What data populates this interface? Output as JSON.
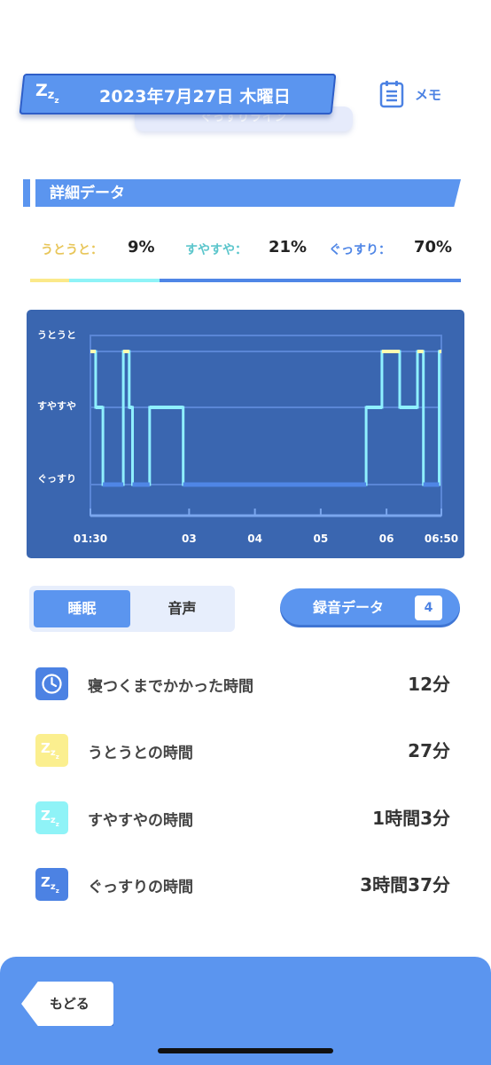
{
  "header": {
    "date": "2023年7月27日 木曜日",
    "memo_label": "メモ",
    "hidden_subtitle": "ぐっすりライン"
  },
  "details": {
    "title": "詳細データ",
    "stats": [
      {
        "label": "うとうと：",
        "value": "9%",
        "color": "#e8c65a"
      },
      {
        "label": "すやすや：",
        "value": "21%",
        "color": "#5cc6cc"
      },
      {
        "label": "ぐっすり：",
        "value": "70%",
        "color": "#4f86e6"
      }
    ]
  },
  "chart_data": {
    "type": "line",
    "step": true,
    "y_levels": [
      "うとうと",
      "すやすや",
      "ぐっすり"
    ],
    "x_ticks": [
      "01:30",
      "03",
      "04",
      "05",
      "06",
      "06:50"
    ],
    "x_range_hours": [
      1.5,
      6.8333
    ],
    "colors": {
      "うとうと": "#fffbb0",
      "すやすや": "#8ff0ff",
      "ぐっすり": "#4f86e6"
    },
    "segments": [
      {
        "start": 1.5,
        "end": 1.58,
        "level": "うとうと"
      },
      {
        "start": 1.58,
        "end": 1.69,
        "level": "すやすや"
      },
      {
        "start": 1.69,
        "end": 2.0,
        "level": "ぐっすり"
      },
      {
        "start": 2.0,
        "end": 2.09,
        "level": "うとうと"
      },
      {
        "start": 2.09,
        "end": 2.14,
        "level": "すやすや"
      },
      {
        "start": 2.14,
        "end": 2.4,
        "level": "ぐっすり"
      },
      {
        "start": 2.4,
        "end": 2.91,
        "level": "すやすや"
      },
      {
        "start": 2.91,
        "end": 5.69,
        "level": "ぐっすり"
      },
      {
        "start": 5.69,
        "end": 5.93,
        "level": "すやすや"
      },
      {
        "start": 5.93,
        "end": 6.2,
        "level": "うとうと"
      },
      {
        "start": 6.2,
        "end": 6.47,
        "level": "すやすや"
      },
      {
        "start": 6.47,
        "end": 6.56,
        "level": "うとうと"
      },
      {
        "start": 6.56,
        "end": 6.8,
        "level": "ぐっすり"
      },
      {
        "start": 6.8,
        "end": 6.8333,
        "level": "うとうと"
      }
    ]
  },
  "tabs": {
    "sleep": "睡眠",
    "audio": "音声"
  },
  "recording": {
    "label": "録音データ",
    "count": "4"
  },
  "summary": [
    {
      "label": "寝つくまでかかった時間",
      "value": "12分",
      "icon": "clock-icon"
    },
    {
      "label": "うとうとの時間",
      "value": "27分",
      "icon": "zzz-yellow-icon"
    },
    {
      "label": "すやすやの時間",
      "value": "1時間3分",
      "icon": "zzz-cyan-icon"
    },
    {
      "label": "ぐっすりの時間",
      "value": "3時間37分",
      "icon": "zzz-blue-icon"
    }
  ],
  "footer": {
    "back_label": "もどる"
  }
}
